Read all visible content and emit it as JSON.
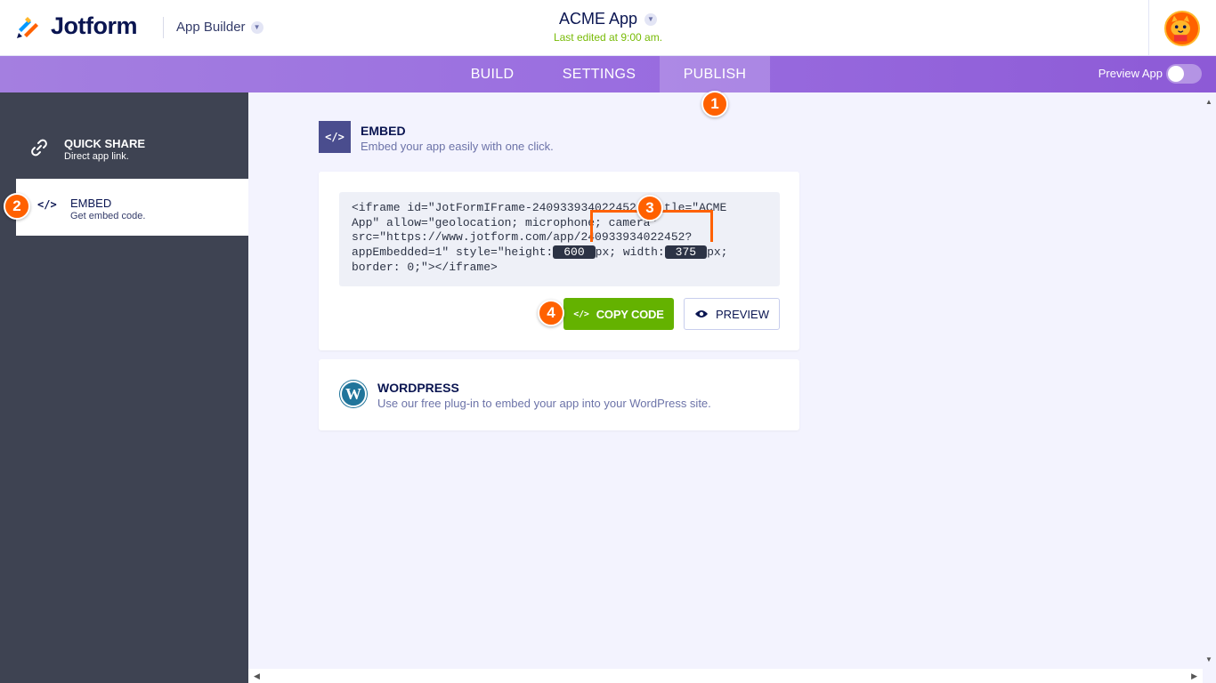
{
  "header": {
    "brand": "Jotform",
    "section": "App Builder",
    "app_name": "ACME App",
    "last_edited": "Last edited at 9:00 am."
  },
  "nav": {
    "tabs": [
      {
        "label": "BUILD"
      },
      {
        "label": "SETTINGS"
      },
      {
        "label": "PUBLISH",
        "active": true
      }
    ],
    "preview_label": "Preview App",
    "preview_enabled": false
  },
  "sidebar": {
    "items": [
      {
        "title": "QUICK SHARE",
        "subtitle": "Direct app link.",
        "icon": "link-icon"
      },
      {
        "title": "EMBED",
        "subtitle": "Get embed code.",
        "icon": "code-icon",
        "active": true
      }
    ]
  },
  "embed": {
    "title": "EMBED",
    "subtitle": "Embed your app easily with one click.",
    "code_line1": "<iframe id=\"JotFormIFrame-240933934022452\" title=\"ACME",
    "code_line2": "App\" allow=\"geolocation; microphone; camera\"",
    "code_line3": "src=\"https://www.jotform.com/app/240933934022452?",
    "code_line4a": "appEmbedded=1\" style=\"height:",
    "height_value": "600",
    "code_line4b": "px; width:",
    "width_value": "375",
    "code_line4c": "px;",
    "code_line5": "border: 0;\"></iframe>",
    "copy_label": "COPY CODE",
    "preview_label": "PREVIEW"
  },
  "wordpress": {
    "title": "WORDPRESS",
    "subtitle": "Use our free plug-in to embed your app into your WordPress site."
  },
  "steps": [
    "1",
    "2",
    "3",
    "4"
  ],
  "colors": {
    "accent_purple": "#9a6ee0",
    "copy_green": "#64b200",
    "step_orange": "#ff6100",
    "sidebar_dark": "#3e4352"
  }
}
